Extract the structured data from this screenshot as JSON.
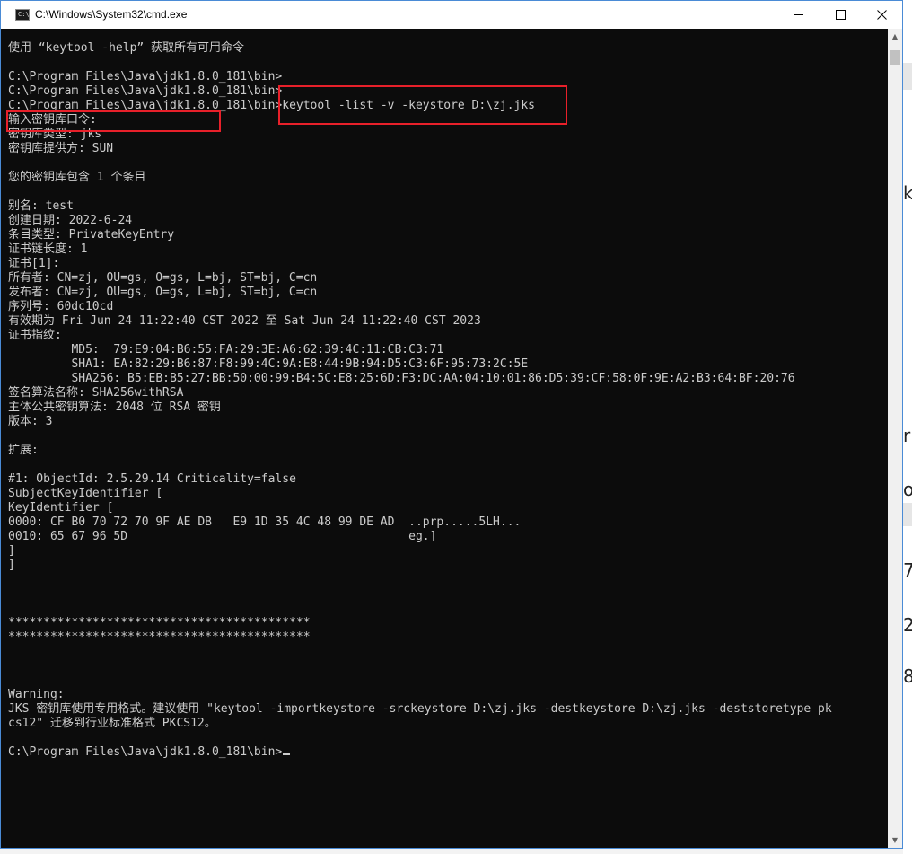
{
  "window": {
    "title": "C:\\Windows\\System32\\cmd.exe",
    "icon_label": "C:\\"
  },
  "console": {
    "lines": [
      "使用 “keytool -help” 获取所有可用命令",
      "",
      "C:\\Program Files\\Java\\jdk1.8.0_181\\bin>",
      "C:\\Program Files\\Java\\jdk1.8.0_181\\bin>",
      "C:\\Program Files\\Java\\jdk1.8.0_181\\bin>keytool -list -v -keystore D:\\zj.jks",
      "输入密钥库口令:",
      "密钥库类型: jks",
      "密钥库提供方: SUN",
      "",
      "您的密钥库包含 1 个条目",
      "",
      "别名: test",
      "创建日期: 2022-6-24",
      "条目类型: PrivateKeyEntry",
      "证书链长度: 1",
      "证书[1]:",
      "所有者: CN=zj, OU=gs, O=gs, L=bj, ST=bj, C=cn",
      "发布者: CN=zj, OU=gs, O=gs, L=bj, ST=bj, C=cn",
      "序列号: 60dc10cd",
      "有效期为 Fri Jun 24 11:22:40 CST 2022 至 Sat Jun 24 11:22:40 CST 2023",
      "证书指纹:",
      "         MD5:  79:E9:04:B6:55:FA:29:3E:A6:62:39:4C:11:CB:C3:71",
      "         SHA1: EA:82:29:B6:87:F8:99:4C:9A:E8:44:9B:94:D5:C3:6F:95:73:2C:5E",
      "         SHA256: B5:EB:B5:27:BB:50:00:99:B4:5C:E8:25:6D:F3:DC:AA:04:10:01:86:D5:39:CF:58:0F:9E:A2:B3:64:BF:20:76",
      "签名算法名称: SHA256withRSA",
      "主体公共密钥算法: 2048 位 RSA 密钥",
      "版本: 3",
      "",
      "扩展:",
      "",
      "#1: ObjectId: 2.5.29.14 Criticality=false",
      "SubjectKeyIdentifier [",
      "KeyIdentifier [",
      "0000: CF B0 70 72 70 9F AE DB   E9 1D 35 4C 48 99 DE AD  ..prp.....5LH...",
      "0010: 65 67 96 5D                                        eg.]",
      "]",
      "]",
      "",
      "",
      "",
      "*******************************************",
      "*******************************************",
      "",
      "",
      "",
      "Warning:",
      "JKS 密钥库使用专用格式。建议使用 \"keytool -importkeystore -srckeystore D:\\zj.jks -destkeystore D:\\zj.jks -deststoretype pk",
      "cs12\" 迁移到行业标准格式 PKCS12。",
      "",
      "C:\\Program Files\\Java\\jdk1.8.0_181\\bin>"
    ]
  },
  "background_fragments": [
    "k",
    "r",
    "o",
    "7",
    "2",
    "8"
  ],
  "colors": {
    "console_bg": "#0c0c0c",
    "console_fg": "#cccccc",
    "highlight": "#e8202a"
  }
}
